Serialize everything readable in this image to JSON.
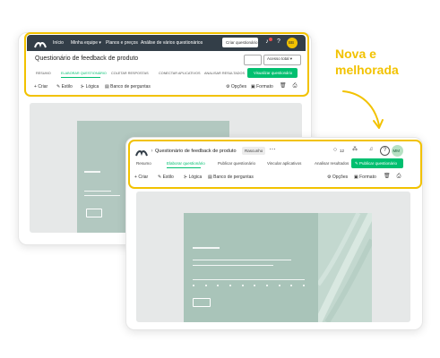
{
  "annotation": {
    "line1": "Nova e",
    "line2": "melhorada"
  },
  "old_ui": {
    "nav": [
      "Início",
      "Minha equipe ▾",
      "Planos e preços",
      "Análise de vários questionários"
    ],
    "create_button": "Criar questionário",
    "avatar": "BB",
    "survey_title": "Questionário de feedback de produto",
    "acesso_button": "Acesso total ▾",
    "preview_button": "Visualizar questionário",
    "tabs": [
      "RESUMO",
      "ELABORAR QUESTIONÁRIO",
      "COLETAR RESPOSTAS",
      "CONECTAR APLICATIVOS",
      "ANALISAR RESULTADOS"
    ],
    "tools": [
      "Criar",
      "Estilo",
      "Lógica",
      "Banco de perguntas"
    ],
    "right_tools": [
      "Opções",
      "Formato"
    ]
  },
  "new_ui": {
    "survey_title": "Questionário de feedback de produto",
    "badge": "Rascunho",
    "comment_count": "12",
    "avatar": "MM",
    "tabs": [
      "Resumo",
      "Elaborar questionário",
      "Publicar questionário",
      "Vincular aplicativos",
      "Analisar resultados"
    ],
    "publish_button": "Publicar questionário",
    "tools": [
      "Criar",
      "Estilo",
      "Lógica",
      "Banco de perguntas"
    ],
    "right_tools": [
      "Opções",
      "Formato"
    ]
  },
  "colors": {
    "green": "#00bf6f",
    "highlight": "#f2c200",
    "dark": "#333e48"
  }
}
